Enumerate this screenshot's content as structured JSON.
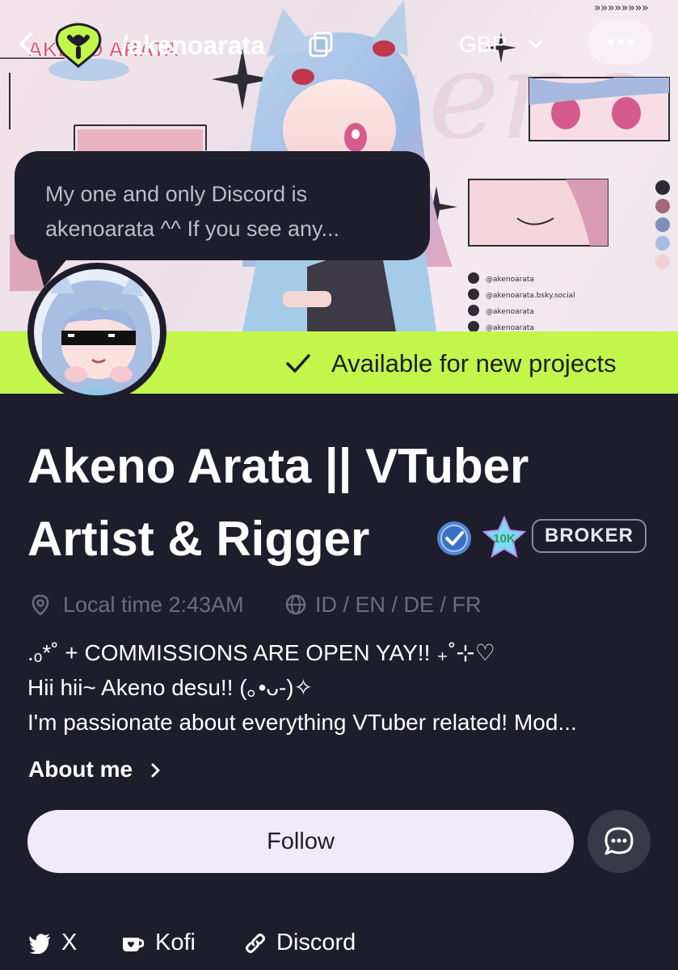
{
  "header": {
    "handle": "/akenoarata",
    "currency": "GBP",
    "back_icon": "chevron-left-icon",
    "logo_icon": "vgen-logo-icon",
    "copy_icon": "copy-icon",
    "more_icon": "more-dots-icon"
  },
  "banner": {
    "logo_text": "AKENO ARATA",
    "social_handles": [
      "@akenoarata",
      "@akenoarata.bsky.social",
      "@akenoarata",
      "@akenoarata"
    ],
    "palette": [
      "#2b2a35",
      "#a36a7a",
      "#7e8fb8",
      "#a8bce0",
      "#f2cfd6"
    ]
  },
  "message": {
    "line1": "My one and only Discord is",
    "line2": "akenoarata ^^ If you see any..."
  },
  "availability": {
    "text": "Available for new projects",
    "color": "#c2f64a"
  },
  "profile": {
    "title_line1": "Akeno Arata || VTuber",
    "title_line2": "Artist & Rigger",
    "badge_broker": "BROKER",
    "badge_10k": "10K",
    "local_time": "Local time 2:43AM",
    "languages": "ID / EN / DE / FR",
    "bio": [
      ".ₒ*˚ + COMMISSIONS ARE OPEN YAY!! ₊˚⊹♡",
      "Hii hii~ Akeno desu!! (｡•ᴗ-)✧",
      "I'm passionate about everything VTuber related! Mod..."
    ],
    "about_label": "About me"
  },
  "actions": {
    "follow_label": "Follow",
    "chat_icon": "chat-bubble-icon"
  },
  "links": [
    {
      "label": "X",
      "icon": "twitter-bird-icon"
    },
    {
      "label": "Kofi",
      "icon": "kofi-cup-icon"
    },
    {
      "label": "Discord",
      "icon": "link-icon"
    }
  ],
  "colors": {
    "background": "#1e1d2b",
    "accent_green": "#c2f64a",
    "follow_bg": "#f1ebf9",
    "muted_text": "#6e6d7b"
  }
}
